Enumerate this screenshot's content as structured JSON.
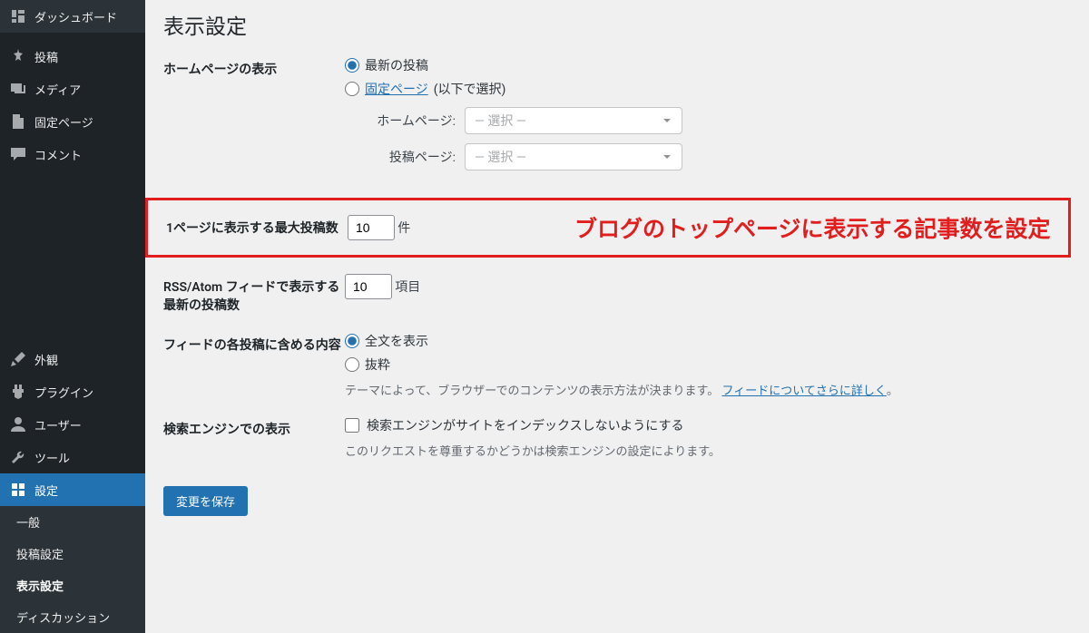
{
  "page_title": "表示設定",
  "annotation": "ブログのトップページに表示する記事数を設定",
  "sidebar": {
    "items": [
      {
        "label": "ダッシュボード",
        "icon": "dashboard"
      },
      {
        "label": "投稿",
        "icon": "pin"
      },
      {
        "label": "メディア",
        "icon": "media"
      },
      {
        "label": "固定ページ",
        "icon": "page"
      },
      {
        "label": "コメント",
        "icon": "comment"
      },
      {
        "label": "外観",
        "icon": "brush"
      },
      {
        "label": "プラグイン",
        "icon": "plugin"
      },
      {
        "label": "ユーザー",
        "icon": "user"
      },
      {
        "label": "ツール",
        "icon": "wrench"
      },
      {
        "label": "設定",
        "icon": "settings",
        "active": true
      }
    ],
    "sub": [
      {
        "label": "一般"
      },
      {
        "label": "投稿設定"
      },
      {
        "label": "表示設定",
        "current": true
      },
      {
        "label": "ディスカッション"
      }
    ]
  },
  "homepage": {
    "label": "ホームページの表示",
    "radio1": "最新の投稿",
    "radio2_link": "固定ページ",
    "radio2_suffix": "(以下で選択)",
    "home_lbl": "ホームページ:",
    "posts_lbl": "投稿ページ:",
    "select_placeholder": "— 選択 —"
  },
  "posts_per_page": {
    "label": "1ページに表示する最大投稿数",
    "value": "10",
    "suffix": "件"
  },
  "rss": {
    "label": "RSS/Atom フィードで表示する最新の投稿数",
    "value": "10",
    "suffix": "項目"
  },
  "feed_content": {
    "label": "フィードの各投稿に含める内容",
    "radio1": "全文を表示",
    "radio2": "抜粋",
    "desc_prefix": "テーマによって、ブラウザーでのコンテンツの表示方法が決まります。",
    "desc_link": "フィードについてさらに詳しく",
    "desc_suffix": "。"
  },
  "search_engine": {
    "label": "検索エンジンでの表示",
    "checkbox_label": "検索エンジンがサイトをインデックスしないようにする",
    "desc": "このリクエストを尊重するかどうかは検索エンジンの設定によります。"
  },
  "save_button": "変更を保存"
}
